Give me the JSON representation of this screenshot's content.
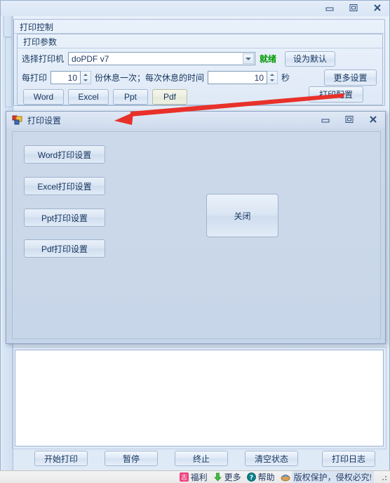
{
  "main_window": {
    "controls": {
      "minimize": "minimize-icon",
      "maximize": "maximize-icon",
      "close": "close-icon"
    }
  },
  "print_control": {
    "group_title": "打印控制",
    "params_group_title": "打印参数",
    "printer_label": "选择打印机",
    "printer_value": "doPDF v7",
    "printer_status": "就绪",
    "printer_status_color": "#009900",
    "set_default_button": "设为默认",
    "interval_prefix_label": "每打印",
    "interval_count_value": "10",
    "interval_middle_label": "份休息一次；每次休息的时间",
    "rest_seconds_value": "10",
    "seconds_label": "秒",
    "more_settings_button": "更多设置",
    "type_buttons": [
      {
        "label": "Word",
        "state": "normal"
      },
      {
        "label": "Excel",
        "state": "normal"
      },
      {
        "label": "Ppt",
        "state": "normal"
      },
      {
        "label": "Pdf",
        "state": "selected"
      }
    ],
    "print_config_button": "打印配置"
  },
  "log_area": {
    "content": ""
  },
  "bottom_buttons": [
    {
      "label": "开始打印"
    },
    {
      "label": "暂停"
    },
    {
      "label": "终止"
    },
    {
      "label": "清空状态"
    },
    {
      "label": "打印日志"
    }
  ],
  "statusbar": {
    "items": [
      {
        "icon": "benefit-icon",
        "icon_glyph": "志",
        "label": "福利"
      },
      {
        "icon": "download-arrow-icon",
        "icon_glyph": "",
        "label": "更多"
      },
      {
        "icon": "help-question-icon",
        "icon_glyph": "?",
        "label": "帮助"
      },
      {
        "icon": "copyright-icon",
        "icon_glyph": "",
        "label": "版权保护，侵权必究!"
      }
    ]
  },
  "dialog": {
    "title": "打印设置",
    "icon": "form-icon",
    "controls": {
      "minimize": "minimize-icon",
      "maximize": "maximize-icon",
      "close": "close-icon"
    },
    "buttons": [
      {
        "label": "Word打印设置",
        "focused": true
      },
      {
        "label": "Excel打印设置",
        "focused": false
      },
      {
        "label": "Ppt打印设置",
        "focused": false
      },
      {
        "label": "Pdf打印设置",
        "focused": false
      }
    ],
    "close_button": "关闭"
  },
  "annotation": {
    "arrow_color": "#e8312a"
  }
}
